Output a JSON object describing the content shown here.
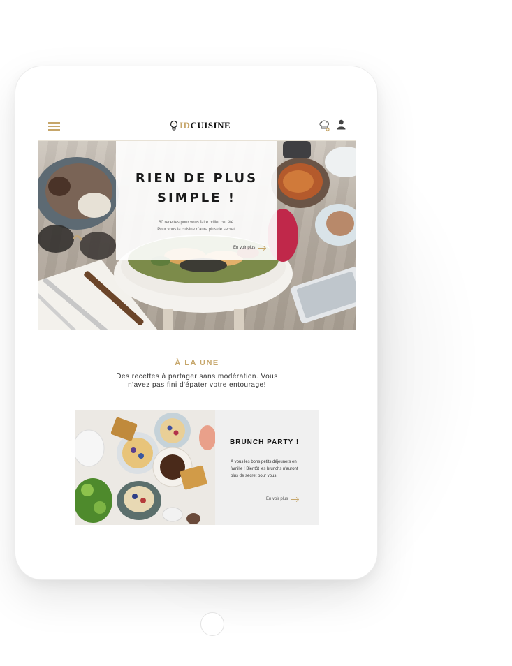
{
  "header": {
    "logo_id": "ID",
    "logo_cuisine": "CUISINE",
    "menu_icon": "hamburger-icon",
    "chef_icon": "chef-hat-icon",
    "user_icon": "user-icon"
  },
  "hero": {
    "title_line1": "RIEN DE PLUS",
    "title_line2": "SIMPLE !",
    "sub_line1": "60 recettes pour vous faire briller cet été.",
    "sub_line2": "Pour vous la cuisine n'aura plus de secret.",
    "more_label": "En voir plus"
  },
  "featured": {
    "title": "À LA UNE",
    "subtitle": "Des recettes à partager sans modération. Vous n'avez pas fini d'épater votre entourage!"
  },
  "card": {
    "title": "BRUNCH PARTY !",
    "text": "À vous les bons petits déjeuners en famille ! Bientôt les brunchs n'auront plus de secret pour vous.",
    "more_label": "En voir plus"
  },
  "colors": {
    "accent": "#c6a66a",
    "text_dark": "#1a1a1a",
    "card_bg": "#f0f0f0"
  }
}
